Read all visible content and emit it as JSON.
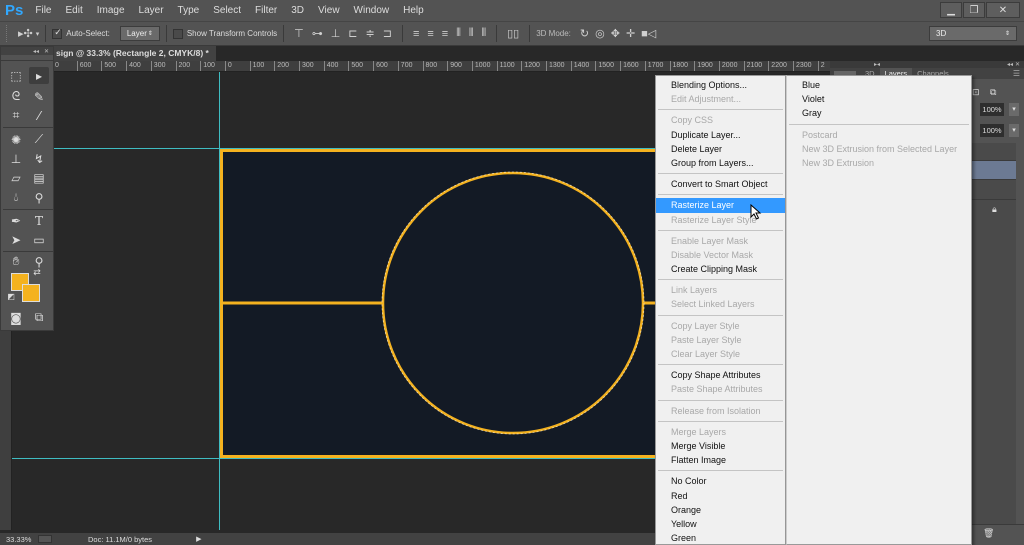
{
  "app": {
    "logo": "Ps",
    "menu": [
      "File",
      "Edit",
      "Image",
      "Layer",
      "Type",
      "Select",
      "Filter",
      "3D",
      "View",
      "Window",
      "Help"
    ],
    "window_controls": {
      "minimize": "▁",
      "restore": "❐",
      "close": "✕"
    }
  },
  "options_bar": {
    "tool_icon": "move-tool-icon",
    "auto_select_label": "Auto-Select:",
    "auto_select_checked": true,
    "auto_select_target": "Layer",
    "show_transform_label": "Show Transform Controls",
    "show_transform_checked": false,
    "mode_3d_label": "3D Mode:",
    "workspace": "3D"
  },
  "document": {
    "tab_title": "sign @ 33.3% (Rectangle 2, CMYK/8) *",
    "tab_close": "×",
    "ruler_labels": [
      "0",
      "600",
      "500",
      "400",
      "300",
      "200",
      "100",
      "0",
      "100",
      "200",
      "300",
      "400",
      "500",
      "600",
      "700",
      "800",
      "900",
      "1000",
      "1100",
      "1200",
      "1300",
      "1400",
      "1500",
      "1600",
      "1700",
      "1800",
      "1900",
      "2000",
      "2100",
      "2200",
      "2300",
      "2"
    ]
  },
  "colors": {
    "foreground": "#f4b21f",
    "background": "#f4b21f",
    "artboard_fill": "#131a25",
    "stroke": "#f4b21f",
    "guide": "#3fbcc2",
    "menu_highlight": "#3399ff"
  },
  "status": {
    "zoom": "33.33%",
    "doc_info": "Doc: 11.1M/0 bytes",
    "arrow": "▶"
  },
  "right_panel": {
    "tabs": [
      "3D",
      "Layers",
      "Channels"
    ],
    "active_tab": "Layers",
    "opacity": "100%",
    "fill": "100%"
  },
  "context_menu": {
    "items": [
      {
        "label": "Blending Options...",
        "enabled": true
      },
      {
        "label": "Edit Adjustment...",
        "enabled": false
      },
      {
        "sep": true
      },
      {
        "label": "Copy CSS",
        "enabled": false
      },
      {
        "label": "Duplicate Layer...",
        "enabled": true
      },
      {
        "label": "Delete Layer",
        "enabled": true
      },
      {
        "label": "Group from Layers...",
        "enabled": true
      },
      {
        "sep": true
      },
      {
        "label": "Convert to Smart Object",
        "enabled": true
      },
      {
        "sep": true
      },
      {
        "label": "Rasterize Layer",
        "enabled": true,
        "highlighted": true
      },
      {
        "label": "Rasterize Layer Style",
        "enabled": false
      },
      {
        "sep": true
      },
      {
        "label": "Enable Layer Mask",
        "enabled": false
      },
      {
        "label": "Disable Vector Mask",
        "enabled": false
      },
      {
        "label": "Create Clipping Mask",
        "enabled": true
      },
      {
        "sep": true
      },
      {
        "label": "Link Layers",
        "enabled": false
      },
      {
        "label": "Select Linked Layers",
        "enabled": false
      },
      {
        "sep": true
      },
      {
        "label": "Copy Layer Style",
        "enabled": false
      },
      {
        "label": "Paste Layer Style",
        "enabled": false
      },
      {
        "label": "Clear Layer Style",
        "enabled": false
      },
      {
        "sep": true
      },
      {
        "label": "Copy Shape Attributes",
        "enabled": true
      },
      {
        "label": "Paste Shape Attributes",
        "enabled": false
      },
      {
        "sep": true
      },
      {
        "label": "Release from Isolation",
        "enabled": false
      },
      {
        "sep": true
      },
      {
        "label": "Merge Layers",
        "enabled": false
      },
      {
        "label": "Merge Visible",
        "enabled": true
      },
      {
        "label": "Flatten Image",
        "enabled": true
      },
      {
        "sep": true
      },
      {
        "label": "No Color",
        "enabled": true
      },
      {
        "label": "Red",
        "enabled": true
      },
      {
        "label": "Orange",
        "enabled": true
      },
      {
        "label": "Yellow",
        "enabled": true
      },
      {
        "label": "Green",
        "enabled": true
      }
    ],
    "column2": [
      {
        "label": "Blue",
        "enabled": true
      },
      {
        "label": "Violet",
        "enabled": true
      },
      {
        "label": "Gray",
        "enabled": true
      },
      {
        "sep": true
      },
      {
        "label": "Postcard",
        "enabled": false
      },
      {
        "label": "New 3D Extrusion from Selected Layer",
        "enabled": false
      },
      {
        "label": "New 3D Extrusion",
        "enabled": false
      }
    ]
  }
}
